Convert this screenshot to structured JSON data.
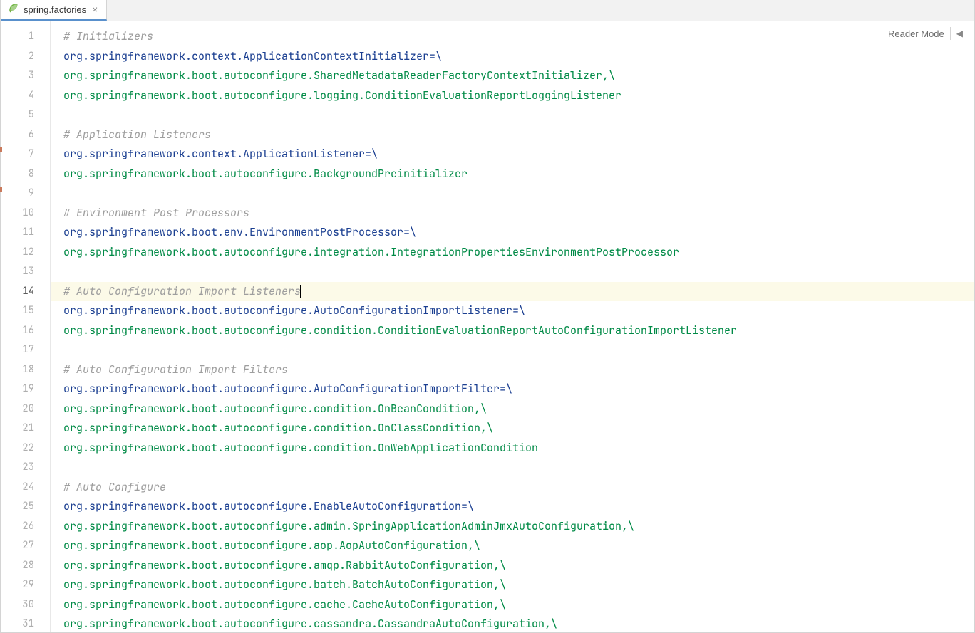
{
  "tab": {
    "label": "spring.factories",
    "icon_name": "spring-leaf-icon"
  },
  "reader_mode_label": "Reader Mode",
  "cursor_line": 14,
  "lines": [
    {
      "n": 1,
      "type": "comment",
      "text": "# Initializers"
    },
    {
      "n": 2,
      "type": "key",
      "text": "org.springframework.context.ApplicationContextInitializer=\\"
    },
    {
      "n": 3,
      "type": "value",
      "text": "org.springframework.boot.autoconfigure.SharedMetadataReaderFactoryContextInitializer,\\"
    },
    {
      "n": 4,
      "type": "value",
      "text": "org.springframework.boot.autoconfigure.logging.ConditionEvaluationReportLoggingListener"
    },
    {
      "n": 5,
      "type": "empty",
      "text": ""
    },
    {
      "n": 6,
      "type": "comment",
      "text": "# Application Listeners"
    },
    {
      "n": 7,
      "type": "key",
      "text": "org.springframework.context.ApplicationListener=\\"
    },
    {
      "n": 8,
      "type": "value",
      "text": "org.springframework.boot.autoconfigure.BackgroundPreinitializer"
    },
    {
      "n": 9,
      "type": "empty",
      "text": ""
    },
    {
      "n": 10,
      "type": "comment",
      "text": "# Environment Post Processors"
    },
    {
      "n": 11,
      "type": "key",
      "text": "org.springframework.boot.env.EnvironmentPostProcessor=\\"
    },
    {
      "n": 12,
      "type": "value",
      "text": "org.springframework.boot.autoconfigure.integration.IntegrationPropertiesEnvironmentPostProcessor"
    },
    {
      "n": 13,
      "type": "empty",
      "text": ""
    },
    {
      "n": 14,
      "type": "comment",
      "text": "# Auto Configuration Import Listeners"
    },
    {
      "n": 15,
      "type": "key",
      "text": "org.springframework.boot.autoconfigure.AutoConfigurationImportListener=\\"
    },
    {
      "n": 16,
      "type": "value",
      "text": "org.springframework.boot.autoconfigure.condition.ConditionEvaluationReportAutoConfigurationImportListener"
    },
    {
      "n": 17,
      "type": "empty",
      "text": ""
    },
    {
      "n": 18,
      "type": "comment",
      "text": "# Auto Configuration Import Filters"
    },
    {
      "n": 19,
      "type": "key",
      "text": "org.springframework.boot.autoconfigure.AutoConfigurationImportFilter=\\"
    },
    {
      "n": 20,
      "type": "value",
      "text": "org.springframework.boot.autoconfigure.condition.OnBeanCondition,\\"
    },
    {
      "n": 21,
      "type": "value",
      "text": "org.springframework.boot.autoconfigure.condition.OnClassCondition,\\"
    },
    {
      "n": 22,
      "type": "value",
      "text": "org.springframework.boot.autoconfigure.condition.OnWebApplicationCondition"
    },
    {
      "n": 23,
      "type": "empty",
      "text": ""
    },
    {
      "n": 24,
      "type": "comment",
      "text": "# Auto Configure"
    },
    {
      "n": 25,
      "type": "key",
      "text": "org.springframework.boot.autoconfigure.EnableAutoConfiguration=\\"
    },
    {
      "n": 26,
      "type": "value",
      "text": "org.springframework.boot.autoconfigure.admin.SpringApplicationAdminJmxAutoConfiguration,\\"
    },
    {
      "n": 27,
      "type": "value",
      "text": "org.springframework.boot.autoconfigure.aop.AopAutoConfiguration,\\"
    },
    {
      "n": 28,
      "type": "value",
      "text": "org.springframework.boot.autoconfigure.amqp.RabbitAutoConfiguration,\\"
    },
    {
      "n": 29,
      "type": "value",
      "text": "org.springframework.boot.autoconfigure.batch.BatchAutoConfiguration,\\"
    },
    {
      "n": 30,
      "type": "value",
      "text": "org.springframework.boot.autoconfigure.cache.CacheAutoConfiguration,\\"
    },
    {
      "n": 31,
      "type": "value",
      "text": "org.springframework.boot.autoconfigure.cassandra.CassandraAutoConfiguration,\\"
    }
  ]
}
